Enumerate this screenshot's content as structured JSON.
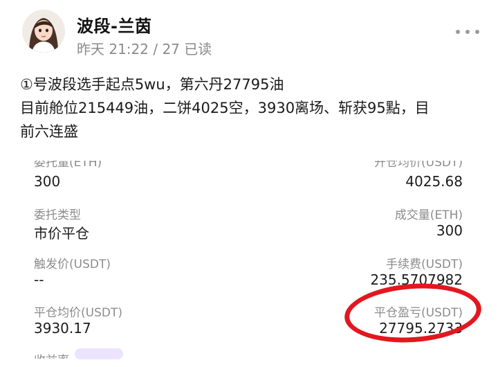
{
  "post": {
    "author": "波段-兰茵",
    "meta": "昨天 21:22 / 27 已读",
    "text_line1": "①号波段选手起点5wu，第六丹27795油",
    "text_line2": "目前舱位215449油，二饼4025空，3930离场、斩获95點，目",
    "text_line3": "前六连盛"
  },
  "order": {
    "row0": {
      "left_label": "委托量(ETH)",
      "left_value": "300",
      "right_label": "开仓均价(USDT)",
      "right_value": "4025.68"
    },
    "row1": {
      "left_label": "委托类型",
      "left_value": "市价平仓",
      "right_label": "成交量(ETH)",
      "right_value": "300"
    },
    "row2": {
      "left_label": "触发价(USDT)",
      "left_value": "--",
      "right_label": "手续费(USDT)",
      "right_value": "235.5707982"
    },
    "row3": {
      "left_label": "平仓均价(USDT)",
      "left_value": "3930.17",
      "right_label": "平仓盈亏(USDT)",
      "right_value": "27795.2733"
    },
    "row4": {
      "left_label": "收益率"
    }
  },
  "colors": {
    "highlight_circle": "#e2171f",
    "label_gray": "#8c8c8c"
  },
  "icons": {
    "more": "more-dots-icon"
  }
}
